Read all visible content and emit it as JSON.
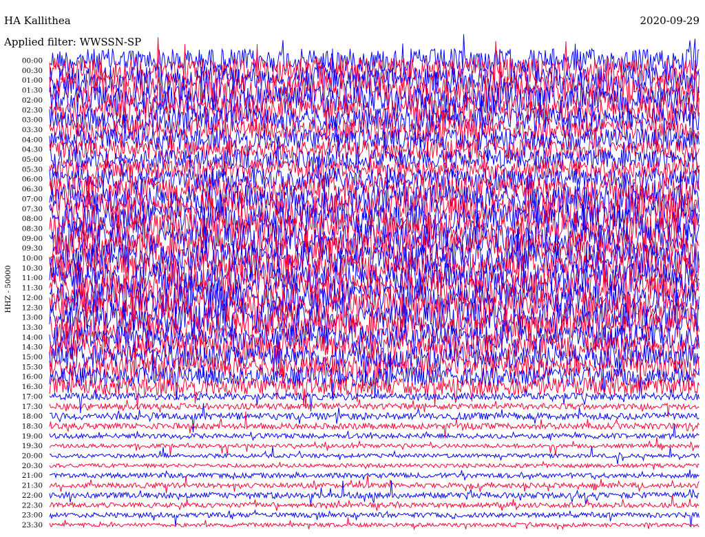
{
  "header": {
    "station": "HA Kallithea",
    "date": "2020-09-29",
    "filter": "Applied filter: WWSSN-SP"
  },
  "chart_data": {
    "type": "line",
    "ylabel": "HHZ - 50000",
    "series_colors": [
      "#0000ff",
      "#ff0033"
    ],
    "tick_labels": [
      "00:00",
      "00:30",
      "01:00",
      "01:30",
      "02:00",
      "02:30",
      "03:00",
      "03:30",
      "04:00",
      "04:30",
      "05:00",
      "05:30",
      "06:00",
      "06:30",
      "07:00",
      "07:30",
      "08:00",
      "08:30",
      "09:00",
      "09:30",
      "10:00",
      "10:30",
      "11:00",
      "11:30",
      "12:00",
      "12:30",
      "13:00",
      "13:30",
      "14:00",
      "14:30",
      "15:00",
      "15:30",
      "16:00",
      "16:30",
      "17:00",
      "17:30",
      "18:00",
      "18:30",
      "19:00",
      "19:30",
      "20:00",
      "20:30",
      "21:00",
      "21:30",
      "22:00",
      "22:30",
      "23:00",
      "23:30"
    ],
    "relative_amplitude": [
      1.2,
      1.3,
      1.4,
      1.5,
      1.4,
      1.3,
      1.2,
      1.1,
      1.1,
      1.0,
      1.0,
      1.0,
      1.1,
      1.3,
      1.4,
      1.5,
      1.5,
      1.5,
      1.5,
      1.5,
      1.5,
      1.5,
      1.5,
      1.5,
      1.5,
      1.5,
      1.5,
      1.4,
      1.3,
      1.3,
      1.2,
      1.1,
      1.0,
      0.9,
      0.35,
      0.3,
      0.35,
      0.3,
      0.25,
      0.2,
      0.2,
      0.2,
      0.25,
      0.25,
      0.3,
      0.25,
      0.25,
      0.2
    ]
  }
}
